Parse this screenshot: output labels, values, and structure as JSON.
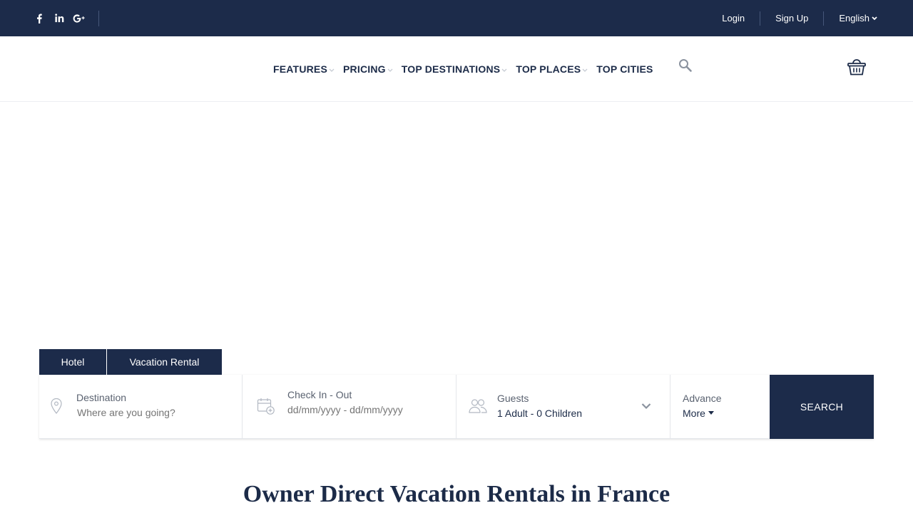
{
  "topbar": {
    "social": [
      {
        "icon": "facebook-icon",
        "glyph": "f"
      },
      {
        "icon": "linkedin-icon",
        "glyph": "in"
      },
      {
        "icon": "google-plus-icon",
        "glyph": "G+"
      }
    ],
    "login_label": "Login",
    "signup_label": "Sign Up",
    "language_label": "English"
  },
  "nav": {
    "items": [
      {
        "label": "FEATURES",
        "has_dropdown": true
      },
      {
        "label": "PRICING",
        "has_dropdown": true
      },
      {
        "label": "TOP DESTINATIONS",
        "has_dropdown": true
      },
      {
        "label": "TOP PLACES",
        "has_dropdown": true
      },
      {
        "label": "TOP CITIES",
        "has_dropdown": false
      }
    ]
  },
  "tabs": {
    "hotel_label": "Hotel",
    "rental_label": "Vacation Rental"
  },
  "search": {
    "destination_label": "Destination",
    "destination_placeholder": "Where are you going?",
    "dates_label": "Check In - Out",
    "dates_value": "dd/mm/yyyy - dd/mm/yyyy",
    "guests_label": "Guests",
    "guests_value": "1 Adult - 0 Children",
    "advance_label": "Advance",
    "more_label": "More",
    "submit_label": "SEARCH"
  },
  "section": {
    "title": "Owner Direct Vacation Rentals in France"
  },
  "colors": {
    "navy": "#1c2b4a",
    "text_dark": "#1c2b48",
    "icon_gray": "#8a929e"
  }
}
